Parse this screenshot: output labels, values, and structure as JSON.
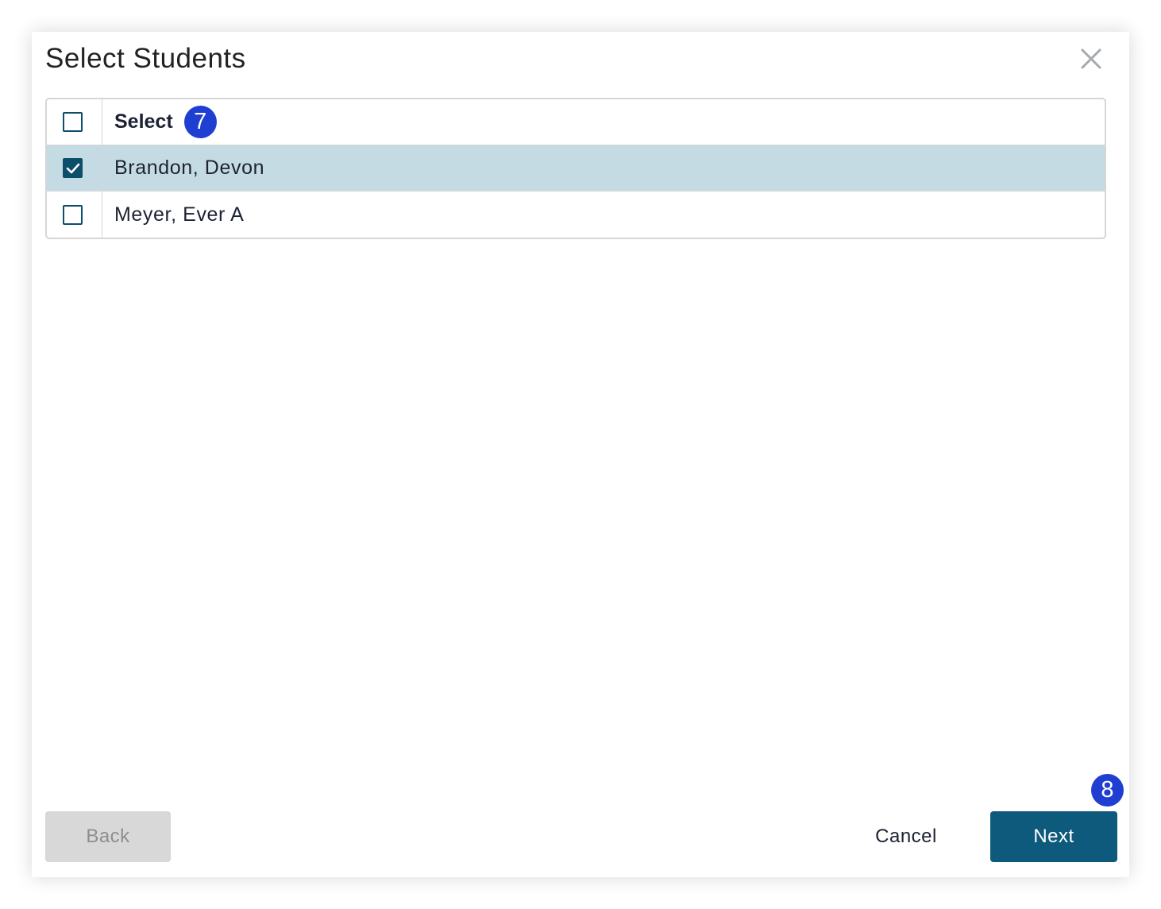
{
  "dialog": {
    "title": "Select Students"
  },
  "table": {
    "header": {
      "label": "Select",
      "checked": false,
      "step_badge": "7"
    },
    "rows": [
      {
        "name": "Brandon, Devon",
        "checked": true
      },
      {
        "name": "Meyer, Ever A",
        "checked": false
      }
    ]
  },
  "footer": {
    "back_label": "Back",
    "cancel_label": "Cancel",
    "next_label": "Next",
    "step_badge": "8"
  },
  "colors": {
    "accent": "#0d5a7c",
    "selected_row": "#c5dbe3",
    "badge": "#1f3fd2",
    "disabled_button": "#d8d8d8"
  }
}
